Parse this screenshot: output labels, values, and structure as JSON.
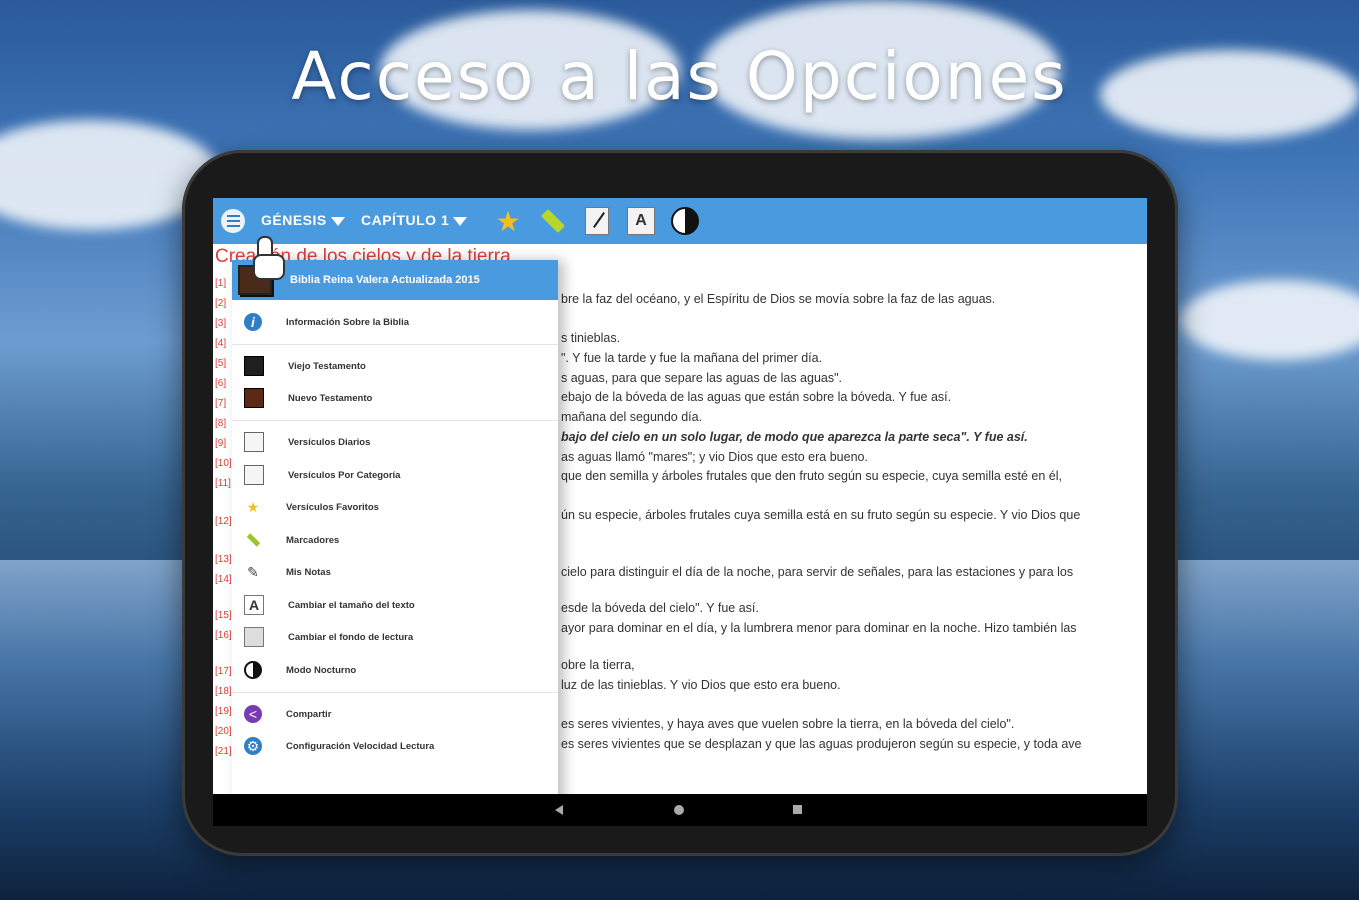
{
  "headline": "Acceso a las Opciones",
  "appbar": {
    "book_dropdown": "GÉNESIS",
    "chapter_dropdown": "CAPÍTULO 1",
    "icons": [
      "menu-icon",
      "star-icon",
      "highlighter-icon",
      "notes-icon",
      "font-size-icon",
      "night-mode-icon"
    ]
  },
  "reader": {
    "chapter_title": "Creación de los cielos y de la tierra",
    "verse_numbers": [
      "[1]",
      "[2]",
      "[3]",
      "[4]",
      "[5]",
      "[6]",
      "[7]",
      "[8]",
      "[9]",
      "[10]",
      "[11]",
      "[12]",
      "[13]",
      "[14]",
      "[15]",
      "[16]",
      "[17]",
      "[18]",
      "[19]",
      "[20]",
      "[21]"
    ],
    "lines": [
      "bre la faz del océano, y el Espíritu de Dios se movía sobre la faz de las aguas.",
      "s tinieblas.",
      "\". Y fue la tarde y fue la mañana del primer día.",
      "s aguas, para que separe las aguas de las aguas\".",
      "ebajo de la bóveda de las aguas que están sobre la bóveda. Y fue así.",
      " mañana del segundo día.",
      "bajo del cielo en un solo lugar, de modo que aparezca la parte seca\". Y fue así.",
      "as aguas llamó \"mares\"; y vio Dios que esto era bueno.",
      " que den semilla y árboles frutales que den fruto según su especie, cuya semilla esté en él,",
      "ún su especie, árboles frutales cuya semilla está en su fruto según su especie. Y vio Dios que",
      " cielo para distinguir el día de la noche, para servir de señales, para las estaciones y para los",
      "esde la bóveda del cielo\". Y fue así.",
      "ayor para dominar en el día, y la lumbrera menor para dominar en la noche. Hizo también las",
      "obre la tierra,",
      " luz de las tinieblas. Y vio Dios que esto era bueno.",
      "es seres vivientes, y haya aves que vuelen sobre la tierra, en la bóveda del cielo\".",
      "es seres vivientes que se desplazan y que las aguas produjeron según su especie, y toda ave"
    ]
  },
  "drawer": {
    "header_title": "Biblia Reina Valera Actualizada 2015",
    "items": [
      {
        "icon": "info-icon",
        "label": "Información Sobre la Biblia"
      },
      {
        "icon": "old-testament-icon",
        "label": "Viejo Testamento"
      },
      {
        "icon": "new-testament-icon",
        "label": "Nuevo Testamento"
      },
      {
        "icon": "daily-verses-icon",
        "label": "Versículos Diarios"
      },
      {
        "icon": "verses-by-category-icon",
        "label": "Versículos Por Categoría"
      },
      {
        "icon": "star-icon",
        "label": "Versículos Favoritos"
      },
      {
        "icon": "bookmark-icon",
        "label": "Marcadores"
      },
      {
        "icon": "notes-icon",
        "label": "Mis Notas"
      },
      {
        "icon": "font-size-icon",
        "label": "Cambiar el tamaño del texto"
      },
      {
        "icon": "reading-background-icon",
        "label": "Cambiar el fondo de lectura"
      },
      {
        "icon": "night-mode-icon",
        "label": "Modo Nocturno"
      },
      {
        "icon": "share-icon",
        "label": "Compartir"
      },
      {
        "icon": "settings-icon",
        "label": "Configuración Velocidad Lectura"
      }
    ]
  },
  "colors": {
    "appbar": "#4a9ae0",
    "verse_number": "#e03b3b",
    "star": "#f2c01d"
  }
}
